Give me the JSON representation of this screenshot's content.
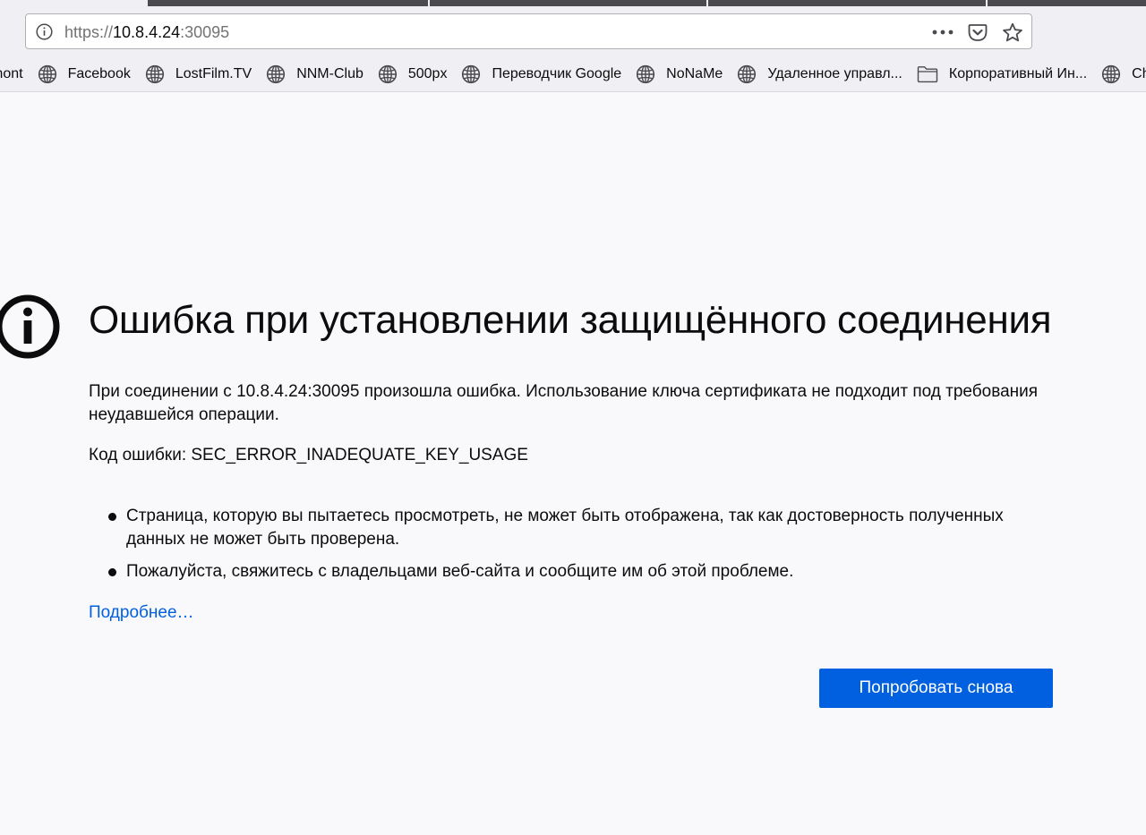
{
  "browser": {
    "url": {
      "scheme": "https://",
      "host": "10.8.4.24",
      "port": ":30095"
    },
    "icons": {
      "site_info": "info-icon",
      "page_actions": "more-horizontal-icon",
      "pocket": "pocket-icon",
      "bookmark": "star-icon"
    },
    "bookmarks": [
      {
        "label": "mont",
        "icon": "none"
      },
      {
        "label": "Facebook",
        "icon": "globe-icon"
      },
      {
        "label": "LostFilm.TV",
        "icon": "globe-icon"
      },
      {
        "label": "NNM-Club",
        "icon": "globe-icon"
      },
      {
        "label": "500px",
        "icon": "globe-icon"
      },
      {
        "label": "Переводчик Google",
        "icon": "globe-icon"
      },
      {
        "label": "NoNaMe",
        "icon": "globe-icon"
      },
      {
        "label": "Удаленное управл...",
        "icon": "globe-icon"
      },
      {
        "label": "Корпоративный Ин...",
        "icon": "folder-icon"
      },
      {
        "label": "China",
        "icon": "globe-icon"
      }
    ]
  },
  "error_page": {
    "icon": "info-circle-icon",
    "title": "Ошибка при установлении защищённого соединения",
    "description": "При соединении с 10.8.4.24:30095 произошла ошибка. Использование ключа сертификата не подходит под требования неудавшейся операции.",
    "error_code": "Код ошибки: SEC_ERROR_INADEQUATE_KEY_USAGE",
    "advice": [
      "Страница, которую вы пытаетесь просмотреть, не может быть отображена, так как достоверность полученных данных не может быть проверена.",
      "Пожалуйста, свяжитесь с владельцами веб-сайта и сообщите им об этой проблеме."
    ],
    "more_link": "Подробнее…",
    "retry_button": "Попробовать снова"
  },
  "colors": {
    "accent": "#0060df",
    "page_background": "#f9f9fb",
    "text": "#0c0c0d"
  }
}
